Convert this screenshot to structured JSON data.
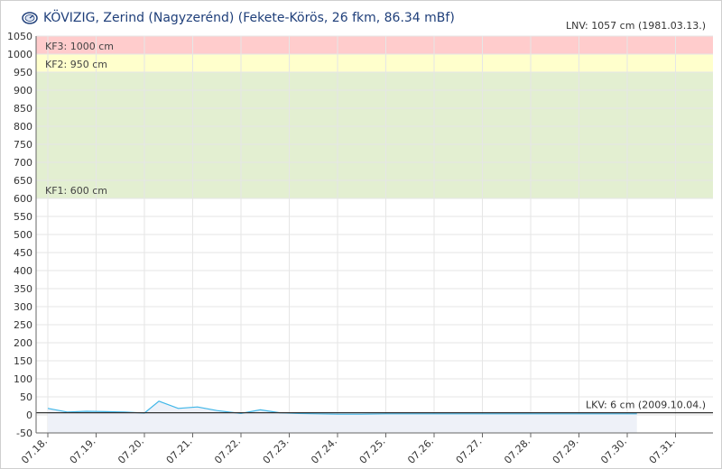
{
  "header": {
    "title": "KÖVIZIG, Zerind (Nagyzerénd) (Fekete-Körös, 26 fkm, 86.34 mBf)",
    "icon": "gauge-icon"
  },
  "chart_data": {
    "type": "line",
    "title": "KÖVIZIG, Zerind (Nagyzerénd) (Fekete-Körös, 26 fkm, 86.34 mBf)",
    "ylim": [
      -50,
      1050
    ],
    "yticks": [
      1050,
      1000,
      950,
      900,
      850,
      800,
      750,
      700,
      650,
      600,
      550,
      500,
      450,
      400,
      350,
      300,
      250,
      200,
      150,
      100,
      50,
      0,
      -50
    ],
    "xticks": [
      "07.18.",
      "07.19.",
      "07.20.",
      "07.21.",
      "07.22.",
      "07.23.",
      "07.24.",
      "07.25.",
      "07.26.",
      "07.27.",
      "07.28.",
      "07.29.",
      "07.30.",
      "07.31."
    ],
    "grid": true,
    "bands": [
      {
        "label": "KF3: 1000 cm",
        "from": 1000,
        "to": 1050,
        "color": "#ffcccc"
      },
      {
        "label": "KF2: 950 cm",
        "from": 950,
        "to": 1000,
        "color": "#ffffcc"
      },
      {
        "label": "KF1: 600 cm",
        "from": 600,
        "to": 950,
        "color": "#e3efd1"
      }
    ],
    "reference_lines": [
      {
        "label": "LNV: 1057 cm (1981.03.13.)",
        "value": 1057
      },
      {
        "label": "LKV: 6 cm (2009.10.04.)",
        "value": 6
      }
    ],
    "series": [
      {
        "color": "#3fb6e8",
        "area_color": "#eef1f8",
        "x": [
          0,
          0.4,
          0.8,
          1.2,
          1.6,
          2.0,
          2.3,
          2.7,
          3.1,
          3.5,
          4.0,
          4.4,
          4.8,
          5.2,
          5.6,
          6.0,
          6.5,
          7.0,
          7.5,
          8.0,
          8.5,
          9.0,
          9.5,
          10.0,
          10.5,
          11.0,
          11.5,
          12.0,
          12.2
        ],
        "values": [
          18,
          8,
          10,
          9,
          8,
          5,
          38,
          18,
          22,
          12,
          4,
          14,
          6,
          4,
          3,
          2,
          2,
          3,
          3,
          3,
          3,
          3,
          3,
          3,
          3,
          3,
          3,
          3,
          3
        ]
      }
    ]
  }
}
